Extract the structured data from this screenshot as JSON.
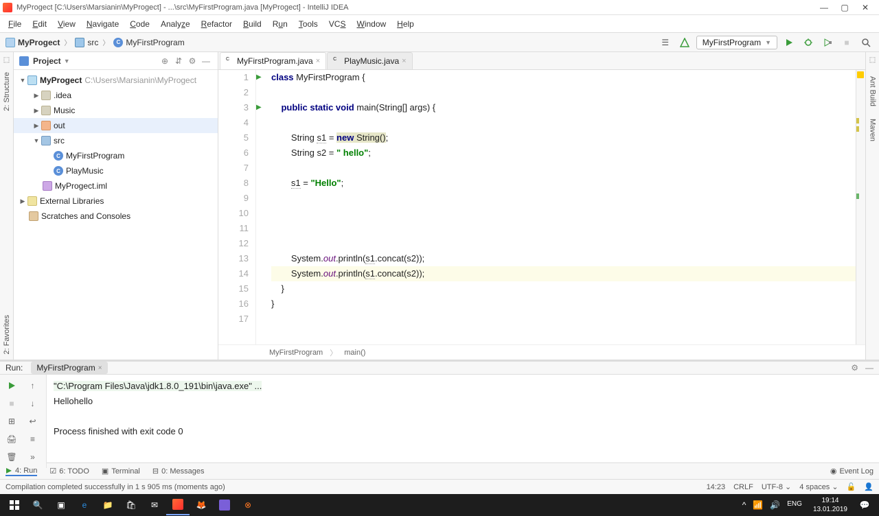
{
  "title": "MyProgect [C:\\Users\\Marsianin\\MyProgect] - ...\\src\\MyFirstProgram.java [MyProgect] - IntelliJ IDEA",
  "menu": [
    "File",
    "Edit",
    "View",
    "Navigate",
    "Code",
    "Analyze",
    "Refactor",
    "Build",
    "Run",
    "Tools",
    "VCS",
    "Window",
    "Help"
  ],
  "breadcrumb": {
    "root": "MyProgect",
    "mid": "src",
    "leaf": "MyFirstProgram"
  },
  "run_config": "MyFirstProgram",
  "project_panel": {
    "title": "Project"
  },
  "tree": {
    "root": "MyProgect",
    "root_path": "C:\\Users\\Marsianin\\MyProgect",
    "idea": ".idea",
    "music": "Music",
    "out": "out",
    "src": "src",
    "cls1": "MyFirstProgram",
    "cls2": "PlayMusic",
    "iml": "MyProgect.iml",
    "ext": "External Libraries",
    "scratch": "Scratches and Consoles"
  },
  "tabs": {
    "t1": "MyFirstProgram.java",
    "t2": "PlayMusic.java"
  },
  "code": {
    "l1a": "class ",
    "l1b": "MyFirstProgram {",
    "l3a": "    public static void ",
    "l3b": "main(String[] args) {",
    "l5a": "        String ",
    "l5v": "s1",
    "l5b": " = ",
    "l5c": "new ",
    "l5d": "String()",
    "l5e": ";",
    "l6a": "        String s2 = ",
    "l6s": "\" hello\"",
    "l6b": ";",
    "l8v": "s1",
    "l8a": " = ",
    "l8s": "\"Hello\"",
    "l8b": ";",
    "l13a": "        System.",
    "l13out": "out",
    "l13b": ".println(",
    "l13v": "s1",
    "l13c": ".concat(s2));",
    "l14a": "        System.",
    "l14out": "out",
    "l14b": ".println(",
    "l14v": "s1",
    "l14c": ".concat(s2));",
    "l15": "    }",
    "l16": "}"
  },
  "crumbs2": {
    "a": "MyFirstProgram",
    "b": "main()"
  },
  "run_tab_label": "Run:",
  "run_tab": "MyFirstProgram",
  "console": {
    "cmd": "\"C:\\Program Files\\Java\\jdk1.8.0_191\\bin\\java.exe\" ...",
    "out1": "Hellohello",
    "exit": "Process finished with exit code 0"
  },
  "bottom": {
    "run": "4: Run",
    "todo": "6: TODO",
    "term": "Terminal",
    "msg": "0: Messages",
    "evlog": "Event Log"
  },
  "status": {
    "msg": "Compilation completed successfully in 1 s 905 ms (moments ago)",
    "pos": "14:23",
    "eol": "CRLF",
    "enc": "UTF-8",
    "ind": "4 spaces"
  },
  "taskbar": {
    "time": "19:14",
    "date": "13.01.2019"
  }
}
